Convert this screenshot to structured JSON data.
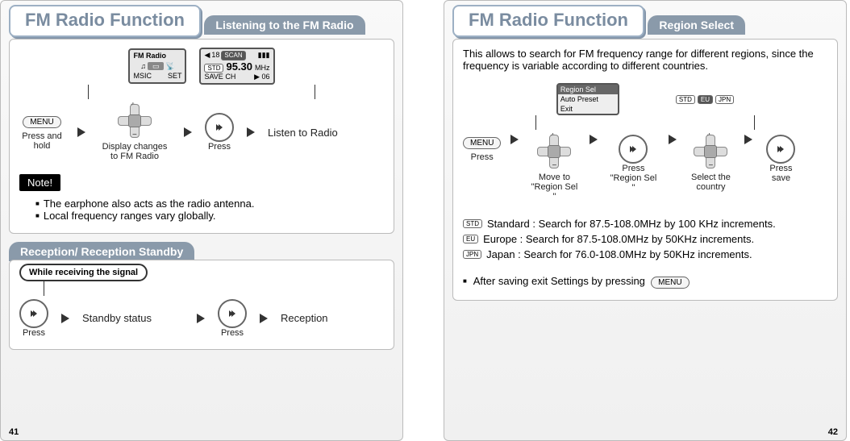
{
  "left": {
    "title": "FM Radio Function",
    "section1": {
      "tab": "Listening to the FM Radio",
      "menu_label": "MENU",
      "press_hold": "Press and hold",
      "display_changes": "Display changes to FM Radio",
      "press": "Press",
      "listen": "Listen to Radio",
      "screen1": {
        "title": "FM Radio",
        "bottom_left": "MSIC",
        "bottom_right": "SET"
      },
      "screen2": {
        "preset": "18",
        "scan": "SCAN",
        "std": "STD",
        "freq": "95.30",
        "unit": "MHz",
        "save": "SAVE CH",
        "ch": "06"
      }
    },
    "note": {
      "label": "Note!",
      "items": [
        "The earphone also acts as the radio antenna.",
        "Local frequency ranges vary globally."
      ]
    },
    "section2": {
      "tab": "Reception/ Reception Standby",
      "callout": "While receiving the signal",
      "press": "Press",
      "standby": "Standby status",
      "reception": "Reception"
    },
    "page_num": "41"
  },
  "right": {
    "title": "FM Radio Function",
    "section": {
      "tab": "Region Select",
      "intro": "This allows to search for FM frequency range for different regions, since the frequency is variable according to different countries.",
      "menu_label": "MENU",
      "press": "Press",
      "move_to": "Move to \"Region Sel \"",
      "press_region": "Press \"Region Sel \"",
      "select_country": "Select the country",
      "press_save": "Press save",
      "regionbox": {
        "hdr": "Region Sel",
        "opt1": "Auto Preset",
        "opt2": "Exit"
      },
      "badges": {
        "std": "STD",
        "eu": "EU",
        "jpn": "JPN"
      },
      "modes": [
        "Standard : Search for 87.5-108.0MHz by 100 KHz increments.",
        "Europe : Search for 87.5-108.0MHz by 50KHz increments.",
        "Japan : Search for 76.0-108.0MHz by 50KHz increments."
      ],
      "exit_note": "After saving exit Settings by pressing"
    },
    "page_num": "42"
  }
}
